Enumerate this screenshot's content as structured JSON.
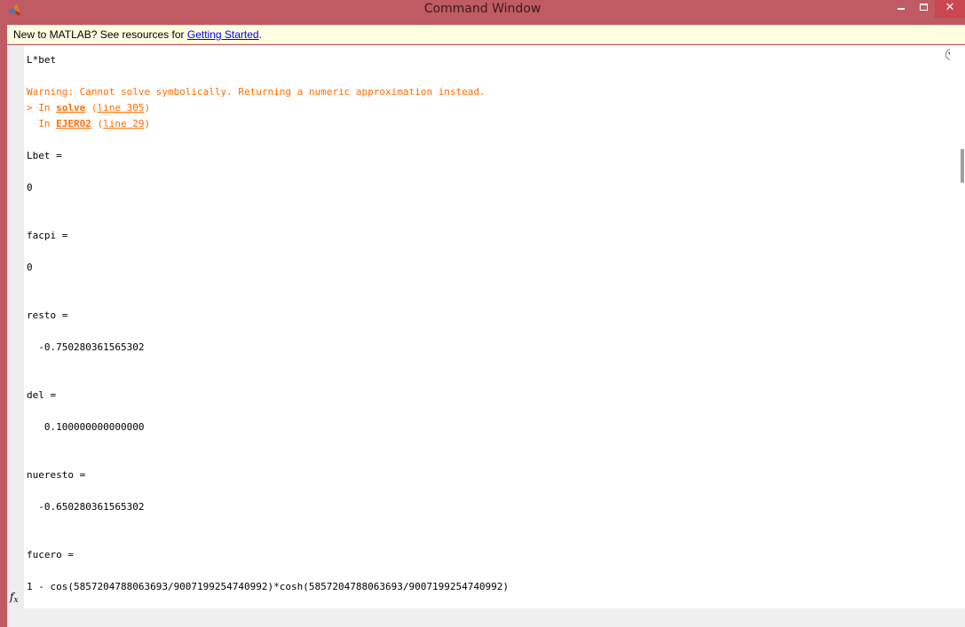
{
  "window": {
    "title": "Command Window",
    "icon": "matlab-logo-icon",
    "controls": {
      "minimize_icon": "minimize-icon",
      "maximize_icon": "maximize-icon",
      "close_glyph": "✕"
    }
  },
  "infobar": {
    "text": "New to MATLAB? See resources for ",
    "link": "Getting Started",
    "suffix": "."
  },
  "console": {
    "lines": {
      "l01": "L*bet",
      "l02": "Warning: Cannot solve symbolically. Returning a numeric approximation instead.",
      "l03_prefix": "> In ",
      "l03_func": "solve",
      "l03_mid": " (",
      "l03_line": "line 305",
      "l03_end": ")",
      "l04_prefix": "  In ",
      "l04_func": "EJER02",
      "l04_mid": " (",
      "l04_line": "line 29",
      "l04_end": ")",
      "l05": "Lbet =",
      "l06": "0",
      "l07": "facpi =",
      "l08": "0",
      "l09": "resto =",
      "l10": "  -0.750280361565302",
      "l11": "del =",
      "l12": "   0.100000000000000",
      "l13": "nueresto =",
      "l14": "  -0.650280361565302",
      "l15": "fucero =",
      "l16": "1 - cos(5857204788063693/9007199254740992)*cosh(5857204788063693/9007199254740992)"
    },
    "prompt_icon": "fx",
    "options_icon": "options-menu-icon"
  },
  "colors": {
    "titlebar": "#c05a63",
    "warning": "#ff6d00",
    "infobar": "#ffffe1",
    "link": "#0000ee"
  }
}
